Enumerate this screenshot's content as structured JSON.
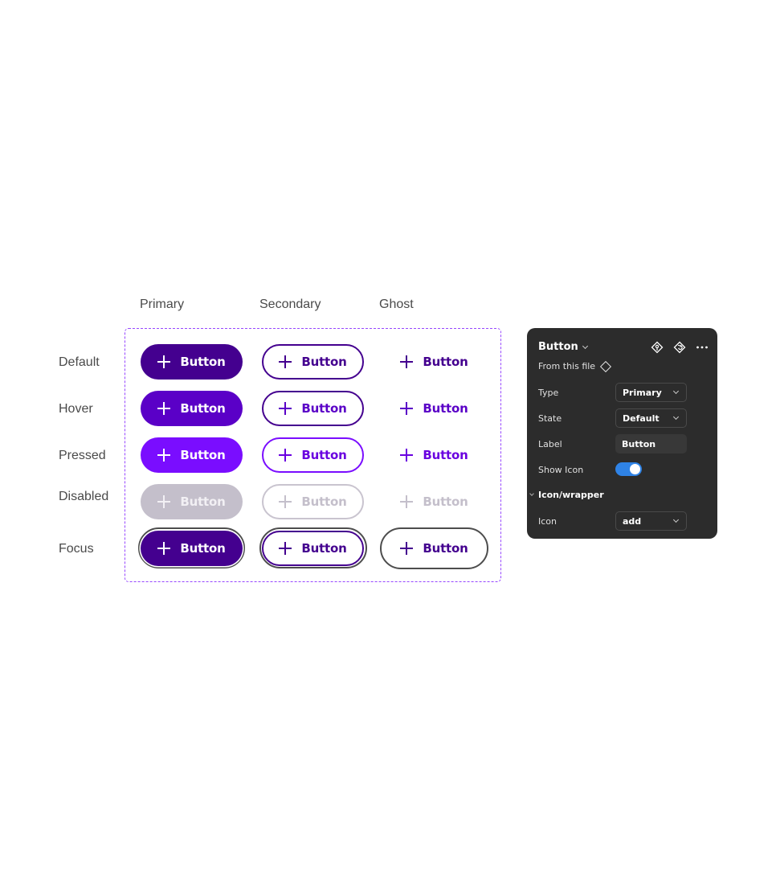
{
  "columns": [
    "Primary",
    "Secondary",
    "Ghost"
  ],
  "rows": [
    "Default",
    "Hover",
    "Pressed",
    "Disabled",
    "Focus"
  ],
  "button_label": "Button",
  "button_icon": "plus-icon",
  "colors": {
    "frame_border": "#9747ff",
    "primary_default": "#44008f",
    "primary_hover": "#5a00c7",
    "primary_pressed": "#7a0dff",
    "disabled": "#c4bfcb",
    "focus_ring": "#4d4d4d",
    "toggle_on": "#2f83e6",
    "panel_bg": "#2c2c2c"
  },
  "panel": {
    "title": "Button",
    "source": "From this file",
    "icons": [
      "component-go-to-main-icon",
      "reset-icon",
      "more-icon"
    ],
    "properties": {
      "type": {
        "label": "Type",
        "value": "Primary"
      },
      "state": {
        "label": "State",
        "value": "Default"
      },
      "label": {
        "label": "Label",
        "value": "Button"
      },
      "show_icon": {
        "label": "Show Icon",
        "value": true
      }
    },
    "section": "Icon/wrapper",
    "icon_prop": {
      "label": "Icon",
      "value": "add"
    }
  }
}
